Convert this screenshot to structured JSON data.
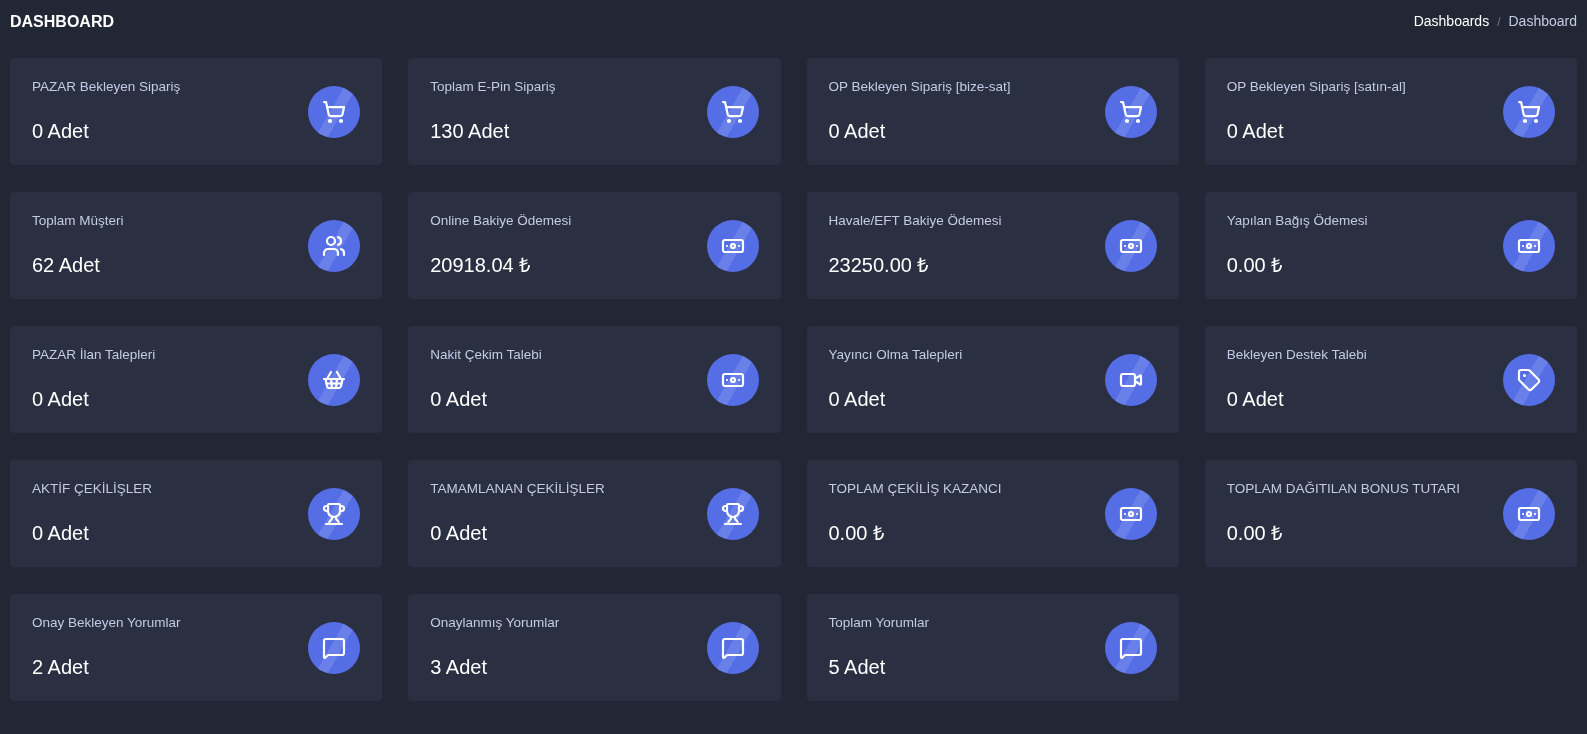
{
  "page_title": "DASHBOARD",
  "breadcrumb_separator": "/",
  "breadcrumb": [
    {
      "label": "Dashboards",
      "selected": false
    },
    {
      "label": "Dashboard",
      "selected": true
    }
  ],
  "cards": [
    {
      "title": "PAZAR Bekleyen Sipariş",
      "value": "0 Adet",
      "kind": "cart"
    },
    {
      "title": "Toplam E-Pin Sipariş",
      "value": "130 Adet",
      "kind": "cart"
    },
    {
      "title": "OP Bekleyen Sipariş [bize-sat]",
      "value": "0 Adet",
      "kind": "cart"
    },
    {
      "title": "OP Bekleyen Sipariş [satın-al]",
      "value": "0 Adet",
      "kind": "cart"
    },
    {
      "title": "Toplam Müşteri",
      "value": "62 Adet",
      "kind": "users"
    },
    {
      "title": "Online Bakiye Ödemesi",
      "value": "20918.04 ₺",
      "kind": "money"
    },
    {
      "title": "Havale/EFT Bakiye Ödemesi",
      "value": "23250.00 ₺",
      "kind": "money"
    },
    {
      "title": "Yapılan Bağış Ödemesi",
      "value": "0.00 ₺",
      "kind": "money"
    },
    {
      "title": "PAZAR İlan Talepleri",
      "value": "0 Adet",
      "kind": "basket"
    },
    {
      "title": "Nakit Çekim Talebi",
      "value": "0 Adet",
      "kind": "money"
    },
    {
      "title": "Yayıncı Olma Talepleri",
      "value": "0 Adet",
      "kind": "video"
    },
    {
      "title": "Bekleyen Destek Talebi",
      "value": "0 Adet",
      "kind": "tag"
    },
    {
      "title": "AKTİF ÇEKİLİŞLER",
      "value": "0 Adet",
      "kind": "trophy"
    },
    {
      "title": "TAMAMLANAN ÇEKİLİŞLER",
      "value": "0 Adet",
      "kind": "trophy"
    },
    {
      "title": "TOPLAM ÇEKİLİŞ KAZANCI",
      "value": "0.00 ₺",
      "kind": "money"
    },
    {
      "title": "TOPLAM DAĞITILAN BONUS TUTARI",
      "value": "0.00 ₺",
      "kind": "money"
    },
    {
      "title": "Onay Bekleyen Yorumlar",
      "value": "2 Adet",
      "kind": "comment"
    },
    {
      "title": "Onaylanmış Yorumlar",
      "value": "3 Adet",
      "kind": "comment"
    },
    {
      "title": "Toplam Yorumlar",
      "value": "5 Adet",
      "kind": "comment"
    }
  ]
}
